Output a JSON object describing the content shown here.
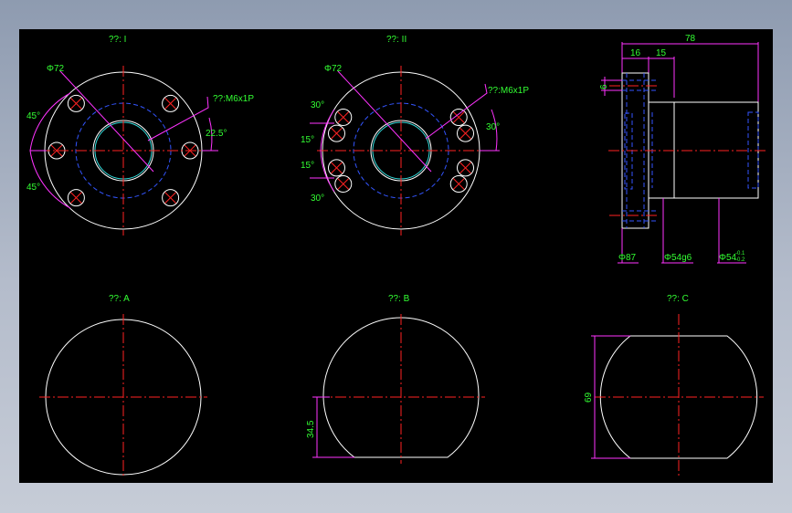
{
  "colors": {
    "background": "#000000",
    "outline": "#ffffff",
    "centerline": "#ff2222",
    "hidden": "#3355ff",
    "dimension": "#ff33ff",
    "annotation": "#33ff33",
    "thread": "#33e0e0"
  },
  "views": {
    "view1": {
      "title": "??: I",
      "diameter": "Φ72",
      "thread": "??:M6x1P",
      "angle_upper": "45°",
      "angle_lower": "45°",
      "angle_right": "22.5°"
    },
    "view2": {
      "title": "??: II",
      "diameter": "Φ72",
      "thread": "??:M6x1P",
      "angle_a": "30°",
      "angle_b": "15°",
      "angle_c": "15°",
      "angle_d": "30°",
      "angle_right": "30°"
    },
    "side": {
      "dim_total": "78",
      "dim_flange": "16",
      "dim_step": "15",
      "dim_hole": "6",
      "dia_flange": "Φ87",
      "dia_body": "Φ54g6",
      "dia_bore": "Φ54",
      "dia_bore_tol_upper": "-0.1",
      "dia_bore_tol_lower": "-0.2"
    },
    "viewA": {
      "title": "??: A"
    },
    "viewB": {
      "title": "??: B",
      "dim_height": "34.5"
    },
    "viewC": {
      "title": "??: C",
      "dim_width": "69"
    }
  }
}
